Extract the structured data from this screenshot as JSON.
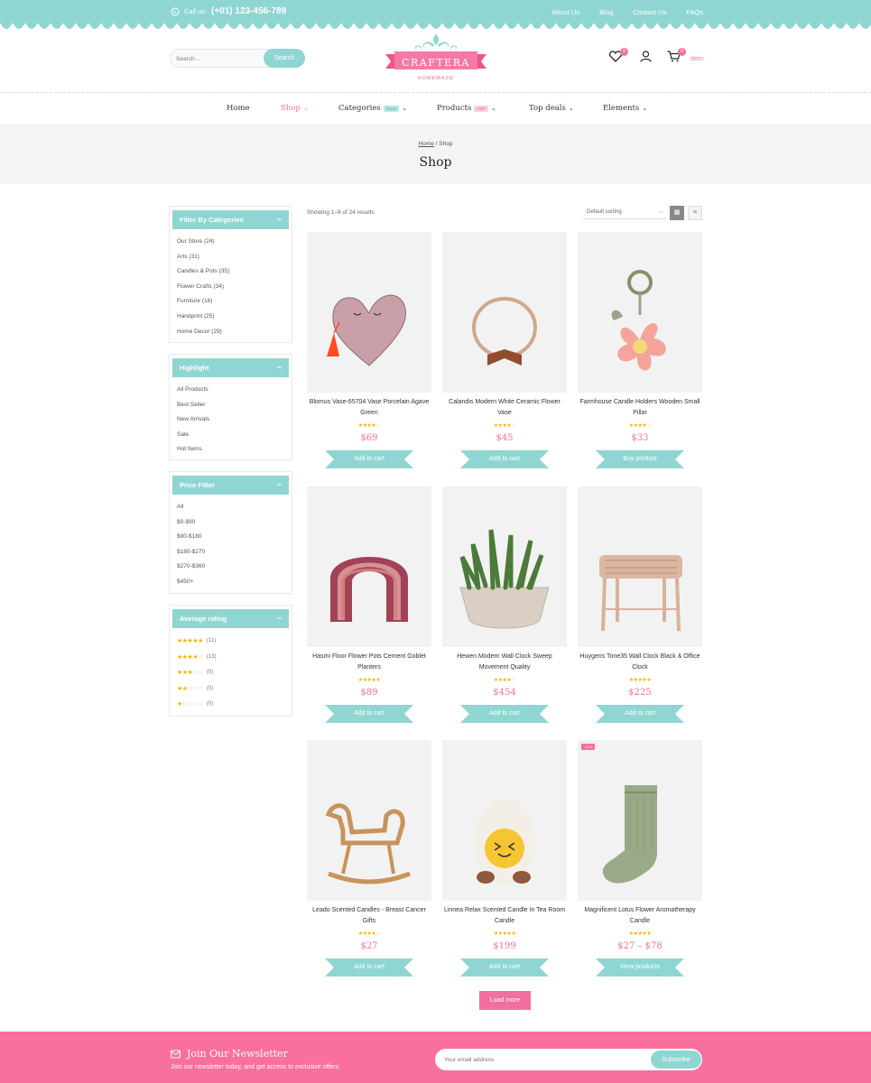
{
  "topbar": {
    "call_label": "Call us:",
    "phone": "(+01) 123-456-789",
    "links": [
      "About Us",
      "Blog",
      "Contact Us",
      "FAQs"
    ]
  },
  "header": {
    "search_placeholder": "Search...",
    "search_button": "Search",
    "logo_name": "CRAFTERA",
    "logo_sub": "HOMEMADE",
    "wishlist_count": "0",
    "cart_count": "0",
    "cart_label": "item"
  },
  "nav": {
    "items": [
      {
        "label": "Home",
        "tag": "",
        "caret": false
      },
      {
        "label": "Shop",
        "tag": "",
        "caret": true
      },
      {
        "label": "Categories",
        "tag": "SALE",
        "caret": true
      },
      {
        "label": "Products",
        "tag": "HOT",
        "caret": true
      },
      {
        "label": "Top deals",
        "tag": "",
        "caret": true
      },
      {
        "label": "Elements",
        "tag": "",
        "caret": true
      }
    ]
  },
  "breadcrumb": {
    "home": "Home",
    "sep": " / ",
    "current": "Shop",
    "title": "Shop"
  },
  "sidebar": {
    "categories": {
      "title": "Filter By Categories",
      "items": [
        "Our Store (24)",
        "Arts (31)",
        "Candles & Pots (35)",
        "Flower Crafts (34)",
        "Furniture (16)",
        "Handprint (25)",
        "Home Decor (29)"
      ]
    },
    "highlight": {
      "title": "Highlight",
      "items": [
        "All Products",
        "Best Seller",
        "New Arrivals",
        "Sale",
        "Hot Items"
      ]
    },
    "price": {
      "title": "Price Filter",
      "items": [
        "All",
        "$0-$90",
        "$90-$180",
        "$180-$270",
        "$270-$360",
        "$450+"
      ]
    },
    "rating": {
      "title": "Average rating",
      "items": [
        {
          "stars": 5,
          "count": "(11)"
        },
        {
          "stars": 4,
          "count": "(13)"
        },
        {
          "stars": 3,
          "count": "(0)"
        },
        {
          "stars": 2,
          "count": "(0)"
        },
        {
          "stars": 1,
          "count": "(0)"
        }
      ]
    }
  },
  "toolbar": {
    "showing": "Showing 1–9 of 24 results",
    "sort": "Default sorting"
  },
  "products": [
    {
      "name": "Blomus Vase-65704 Vase Porcelain Agave Green",
      "rating": 4,
      "price": "$69",
      "button": "Add to cart",
      "image": "heart-purse",
      "badge": ""
    },
    {
      "name": "Calandis Modern White Ceramic Flower Vase",
      "rating": 4,
      "price": "$45",
      "button": "Add to cart",
      "image": "headband",
      "badge": ""
    },
    {
      "name": "Farmhouse Candle Holders Wooden Small Pillar",
      "rating": 4,
      "price": "$33",
      "button": "Buy product",
      "image": "flower-toy",
      "badge": ""
    },
    {
      "name": "Hasmi Floor Flower Pots Cement Goblet Planters",
      "rating": 5,
      "price": "$89",
      "button": "Add to cart",
      "image": "rainbow-pillow",
      "badge": ""
    },
    {
      "name": "Hewen Modern Wall Clock Sweep Movement Quality",
      "rating": 4,
      "price": "$454",
      "button": "Add to cart",
      "image": "plant-pot",
      "badge": ""
    },
    {
      "name": "Huygens Tone35 Wall Clock Black & Office Clock",
      "rating": 5,
      "price": "$225",
      "button": "Add to cart",
      "image": "rattan-stool",
      "badge": ""
    },
    {
      "name": "Leado Scented Candles - Breast Cancer Gifts",
      "rating": 4,
      "price": "$27",
      "button": "Add to cart",
      "image": "rocking-horse",
      "badge": ""
    },
    {
      "name": "Linnea Relax Scented Candle In Tea Room Candle",
      "rating": 5,
      "price": "$199",
      "button": "Add to cart",
      "image": "egg-plush",
      "badge": ""
    },
    {
      "name": "Magnificent Lotus Flower Aromatherapy Candle",
      "rating": 5,
      "price": "$27 – $78",
      "button": "View products",
      "image": "green-sock",
      "badge": "-12%"
    }
  ],
  "load_more": "Load more",
  "newsletter": {
    "title": "Join Our Newsletter",
    "subtitle": "Join our newsletter today, and get access to exclusive offers.",
    "placeholder": "Your email address",
    "button": "Subscribe"
  },
  "colors": {
    "teal": "#8fd6d2",
    "pink": "#f36f9f",
    "star": "#f5b301"
  }
}
